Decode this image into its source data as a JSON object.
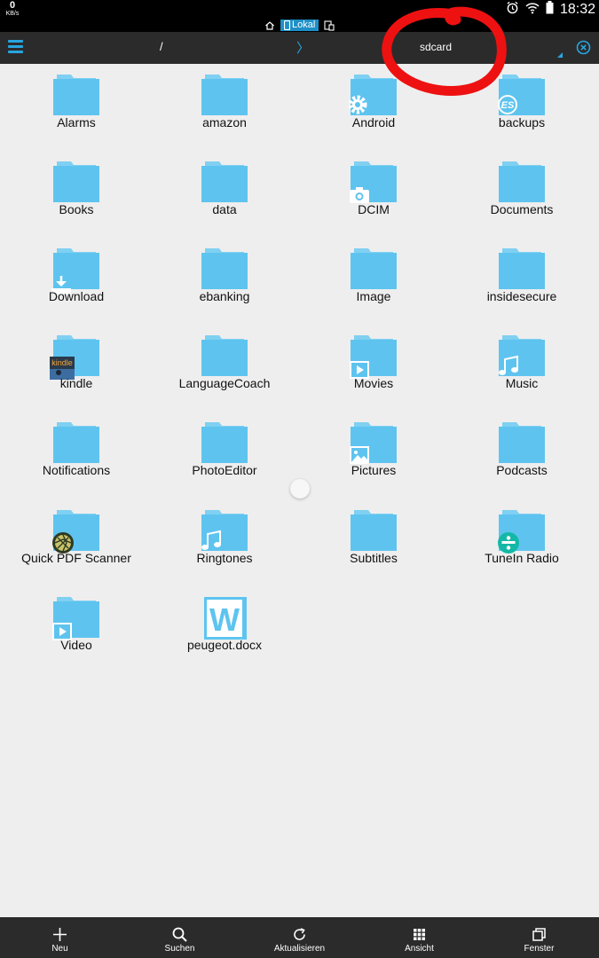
{
  "status_bar": {
    "speed_value": "0",
    "speed_unit": "KB/s",
    "time": "18:32"
  },
  "location": {
    "tag_label": "Lokal"
  },
  "toolbar": {
    "path_root": "/",
    "path_separator": "〉",
    "path_current": "sdcard"
  },
  "colors": {
    "folder": "#5ec4ef",
    "folder_tab": "#7fd0f2",
    "accent": "#27a6e0",
    "toolbar_bg": "#2b2b2b",
    "annotation": "#ee1111"
  },
  "items": [
    {
      "label": "Alarms",
      "type": "folder"
    },
    {
      "label": "amazon",
      "type": "folder"
    },
    {
      "label": "Android",
      "type": "folder",
      "badge": "gear-icon"
    },
    {
      "label": "backups",
      "type": "folder",
      "badge": "es-icon"
    },
    {
      "label": "Books",
      "type": "folder"
    },
    {
      "label": "data",
      "type": "folder"
    },
    {
      "label": "DCIM",
      "type": "folder",
      "badge": "camera-icon"
    },
    {
      "label": "Documents",
      "type": "folder"
    },
    {
      "label": "Download",
      "type": "folder",
      "badge": "download-icon"
    },
    {
      "label": "ebanking",
      "type": "folder"
    },
    {
      "label": "Image",
      "type": "folder"
    },
    {
      "label": "insidesecure",
      "type": "folder"
    },
    {
      "label": "kindle",
      "type": "folder",
      "badge": "kindle-icon",
      "badge_text": "kindle"
    },
    {
      "label": "LanguageCoach",
      "type": "folder"
    },
    {
      "label": "Movies",
      "type": "folder",
      "badge": "play-icon"
    },
    {
      "label": "Music",
      "type": "folder",
      "badge": "music-note-icon"
    },
    {
      "label": "Notifications",
      "type": "folder"
    },
    {
      "label": "PhotoEditor",
      "type": "folder"
    },
    {
      "label": "Pictures",
      "type": "folder",
      "badge": "picture-icon"
    },
    {
      "label": "Podcasts",
      "type": "folder"
    },
    {
      "label": "Quick PDF Scanner",
      "type": "folder",
      "badge": "aperture-icon"
    },
    {
      "label": "Ringtones",
      "type": "folder",
      "badge": "music-note-icon"
    },
    {
      "label": "Subtitles",
      "type": "folder"
    },
    {
      "label": "TuneIn Radio",
      "type": "folder",
      "badge": "tunein-icon"
    },
    {
      "label": "Video",
      "type": "folder",
      "badge": "play-icon"
    },
    {
      "label": "peugeot.docx",
      "type": "word-document",
      "badge_text": "W"
    }
  ],
  "bottom_bar": [
    {
      "label": "Neu",
      "icon": "plus-icon"
    },
    {
      "label": "Suchen",
      "icon": "search-icon"
    },
    {
      "label": "Aktualisieren",
      "icon": "refresh-icon"
    },
    {
      "label": "Ansicht",
      "icon": "grid-view-icon"
    },
    {
      "label": "Fenster",
      "icon": "windows-icon"
    }
  ]
}
